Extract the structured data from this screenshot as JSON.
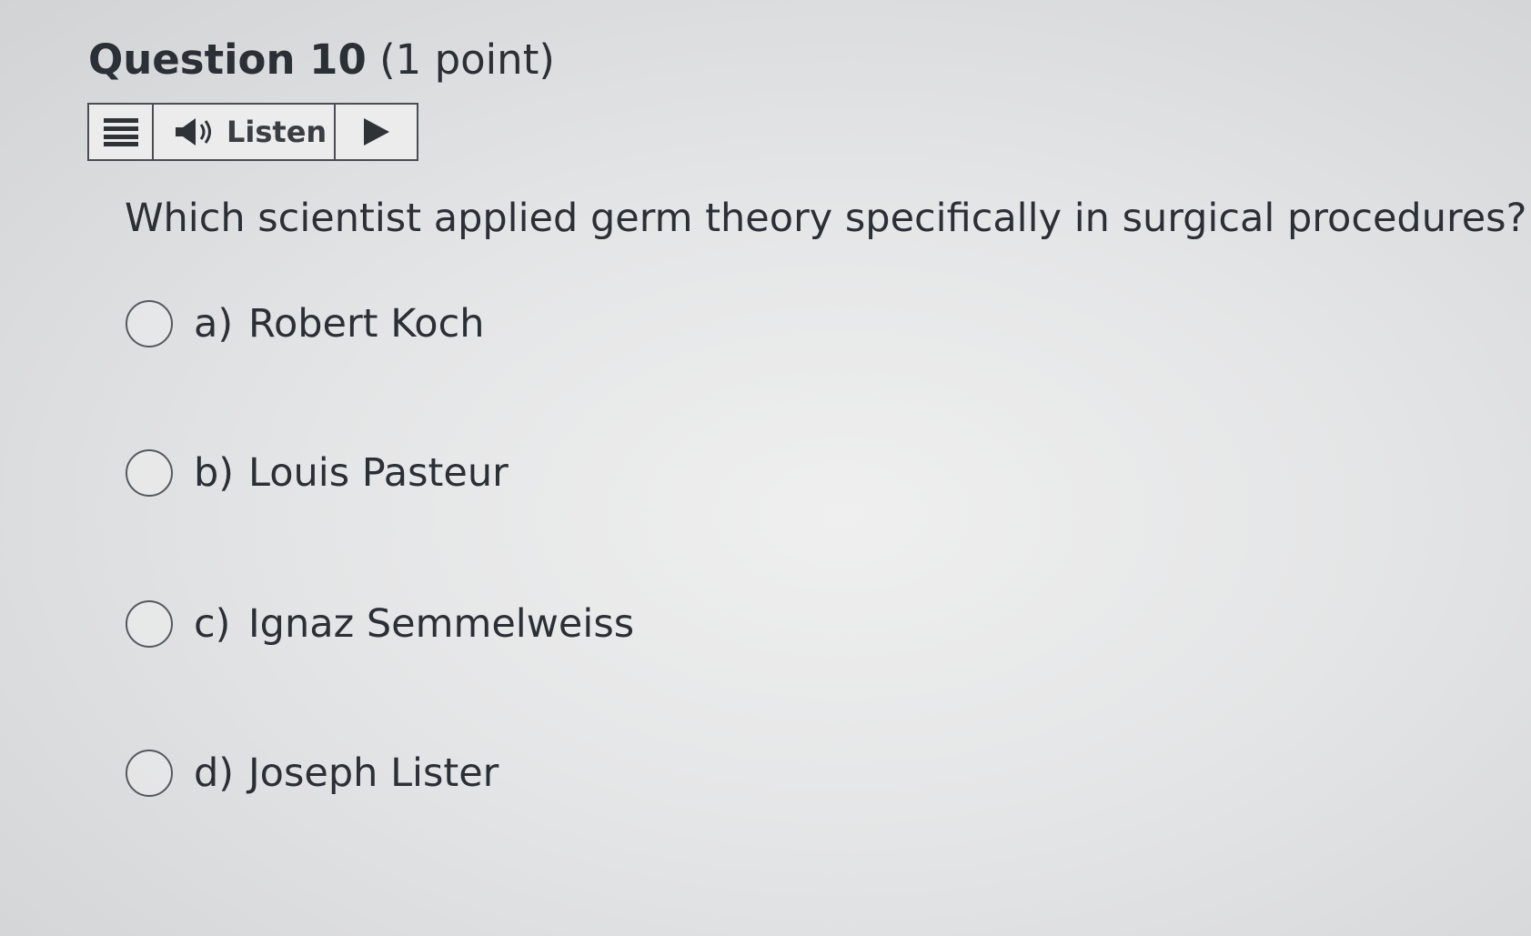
{
  "question": {
    "number_label": "Question 10",
    "points_label": "(1 point)",
    "text": "Which scientist applied germ theory specifically in surgical procedures?"
  },
  "listen_bar": {
    "menu_icon": "menu-icon",
    "speaker_icon": "speaker-icon",
    "listen_label": "Listen",
    "play_icon": "play-icon"
  },
  "options": [
    {
      "letter": "a)",
      "text": "Robert Koch",
      "selected": false
    },
    {
      "letter": "b)",
      "text": "Louis Pasteur",
      "selected": false
    },
    {
      "letter": "c)",
      "text": "Ignaz Semmelweiss",
      "selected": false
    },
    {
      "letter": "d)",
      "text": "Joseph Lister",
      "selected": false
    }
  ]
}
